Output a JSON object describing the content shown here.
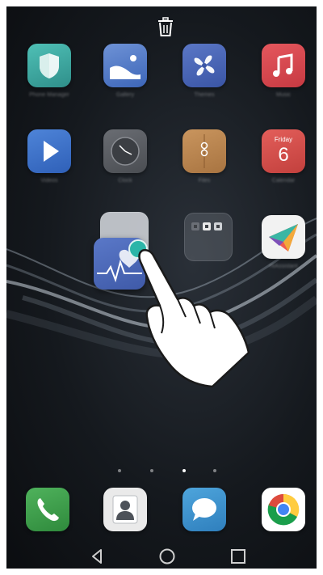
{
  "home": {
    "apps": [
      {
        "name": "Phone Manager",
        "icon": "shield-icon",
        "color": "#3fa9a3"
      },
      {
        "name": "Gallery",
        "icon": "landscape-icon",
        "color": "#5b7fc4"
      },
      {
        "name": "Themes",
        "icon": "pinwheel-icon",
        "color": "#4a63b0"
      },
      {
        "name": "Music",
        "icon": "music-note-icon",
        "color": "#d9474e"
      },
      {
        "name": "Videos",
        "icon": "play-icon",
        "color": "#3b6fc9"
      },
      {
        "name": "Clock",
        "icon": "clock-icon",
        "color": "#5d6066"
      },
      {
        "name": "Files",
        "icon": "folder-icon",
        "color": "#b9854e"
      },
      {
        "name": "Calendar",
        "icon": "calendar-icon",
        "color": "#d9514d"
      },
      {
        "name": "HiAssistant",
        "icon": "paper-plane-icon",
        "color": "#f2f2f2"
      }
    ],
    "calendar": {
      "day_name": "Friday",
      "day_number": "6"
    },
    "dragged_app": {
      "icon": "health-heart-icon",
      "color": "#4a66b6"
    },
    "page_indicator": {
      "count": 4,
      "active_index": 2
    }
  },
  "dock": [
    {
      "name": "Phone",
      "icon": "phone-icon",
      "color": "#3a9d4a"
    },
    {
      "name": "Contacts",
      "icon": "contact-icon",
      "color": "#e9e9e9"
    },
    {
      "name": "Messages",
      "icon": "chat-bubble-icon",
      "color": "#3b8fc9"
    },
    {
      "name": "Chrome",
      "icon": "chrome-icon",
      "color": "#ffffff"
    }
  ],
  "navbar": {
    "back": "back-icon",
    "home": "home-icon",
    "recents": "recents-icon"
  }
}
